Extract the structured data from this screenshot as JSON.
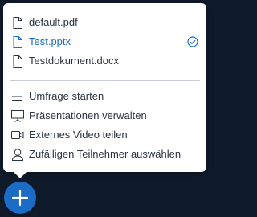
{
  "files": [
    {
      "name": "default.pdf",
      "icon": "file-icon",
      "selected": false
    },
    {
      "name": "Test.pptx",
      "icon": "file-icon",
      "selected": true
    },
    {
      "name": "Testdokument.docx",
      "icon": "file-icon",
      "selected": false
    }
  ],
  "actions": [
    {
      "label": "Umfrage starten",
      "icon": "poll-icon"
    },
    {
      "label": "Präsentationen verwalten",
      "icon": "presentation-icon"
    },
    {
      "label": "Externes Video teilen",
      "icon": "video-icon"
    },
    {
      "label": "Zufälligen Teilnehmer auswählen",
      "icon": "user-icon"
    }
  ],
  "colors": {
    "accent": "#1b6cc4",
    "text": "#2b3440",
    "background": "#0f1b2b"
  }
}
